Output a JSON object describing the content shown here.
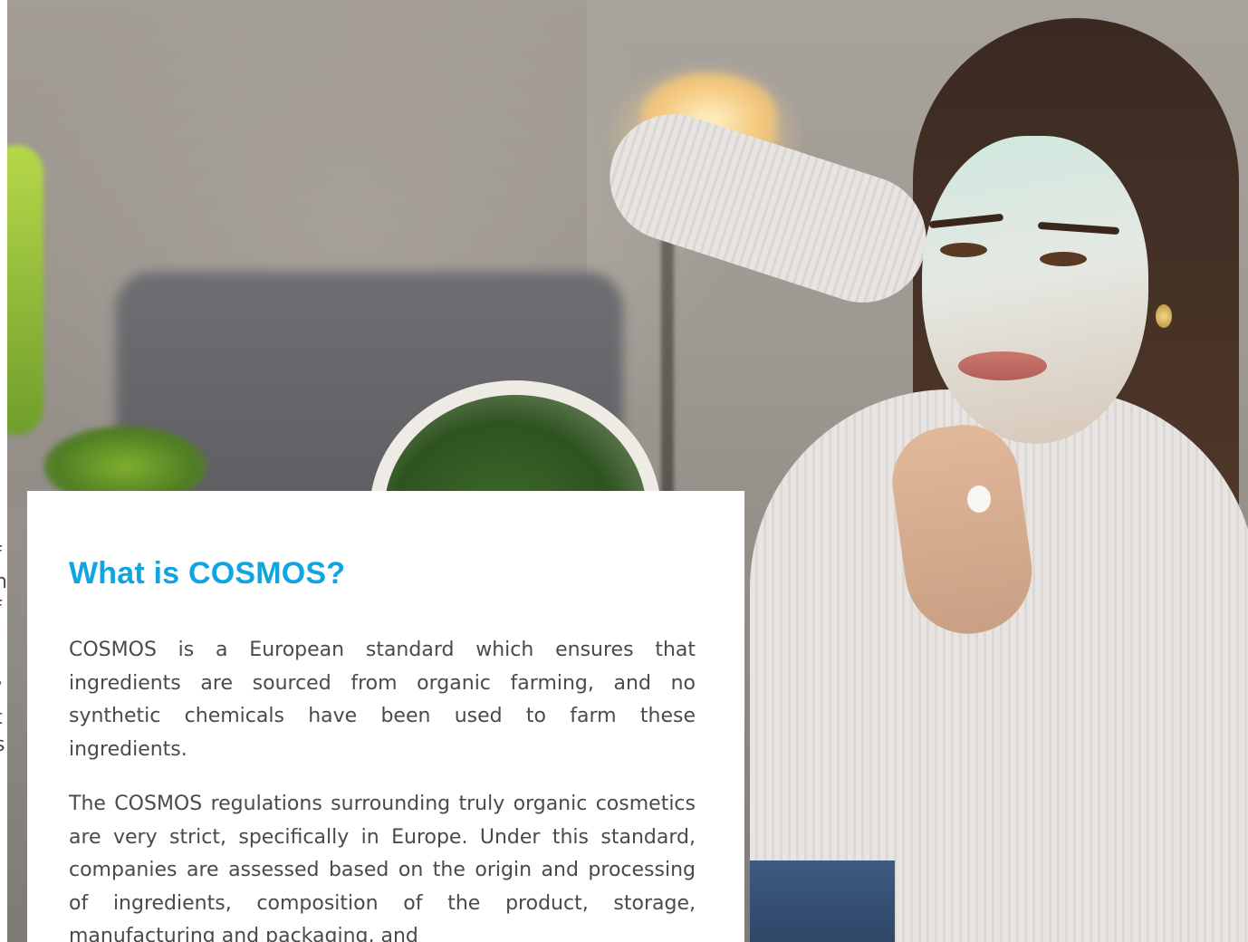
{
  "hero_image": {
    "alt": "Woman applying a mint green face mask in front of a mirror"
  },
  "side_column": {
    "clipped_glyphs": [
      "f",
      "n",
      "f",
      ".",
      "/",
      "t",
      "s"
    ]
  },
  "article": {
    "title": "What is COSMOS?",
    "paragraphs": [
      "COSMOS is a European standard which ensures that ingredients are sourced from organic farming, and no synthetic chemicals have been used to farm these ingredients.",
      "The COSMOS regulations surrounding truly organic cosmetics are very strict, specifically in Europe. Under this standard, companies are assessed based on the origin and processing of ingredients, composition of the product, storage, manufacturing and packaging, and"
    ]
  },
  "colors": {
    "title": "#0ea5e0",
    "body_text": "#4a4a4a",
    "card_background": "#ffffff"
  }
}
